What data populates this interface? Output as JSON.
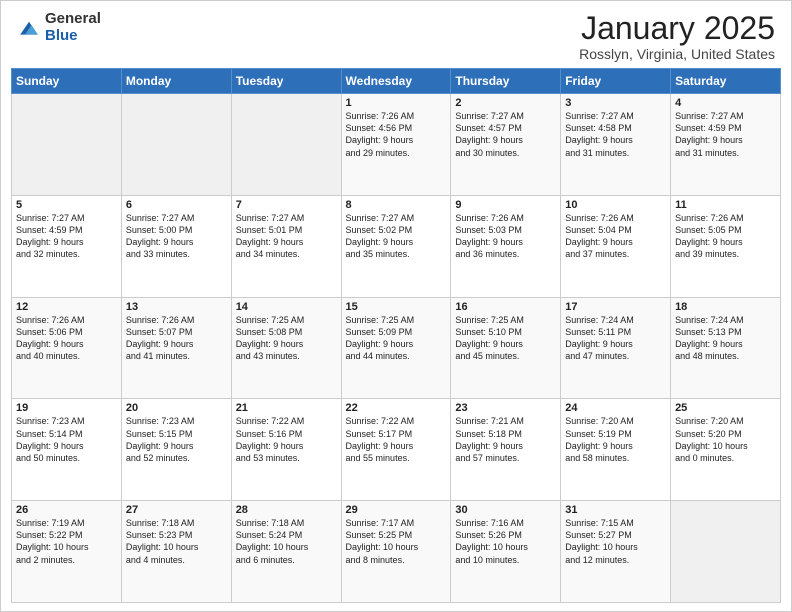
{
  "logo": {
    "general": "General",
    "blue": "Blue"
  },
  "title": "January 2025",
  "subtitle": "Rosslyn, Virginia, United States",
  "days_of_week": [
    "Sunday",
    "Monday",
    "Tuesday",
    "Wednesday",
    "Thursday",
    "Friday",
    "Saturday"
  ],
  "weeks": [
    [
      {
        "day": "",
        "content": ""
      },
      {
        "day": "",
        "content": ""
      },
      {
        "day": "",
        "content": ""
      },
      {
        "day": "1",
        "content": "Sunrise: 7:26 AM\nSunset: 4:56 PM\nDaylight: 9 hours\nand 29 minutes."
      },
      {
        "day": "2",
        "content": "Sunrise: 7:27 AM\nSunset: 4:57 PM\nDaylight: 9 hours\nand 30 minutes."
      },
      {
        "day": "3",
        "content": "Sunrise: 7:27 AM\nSunset: 4:58 PM\nDaylight: 9 hours\nand 31 minutes."
      },
      {
        "day": "4",
        "content": "Sunrise: 7:27 AM\nSunset: 4:59 PM\nDaylight: 9 hours\nand 31 minutes."
      }
    ],
    [
      {
        "day": "5",
        "content": "Sunrise: 7:27 AM\nSunset: 4:59 PM\nDaylight: 9 hours\nand 32 minutes."
      },
      {
        "day": "6",
        "content": "Sunrise: 7:27 AM\nSunset: 5:00 PM\nDaylight: 9 hours\nand 33 minutes."
      },
      {
        "day": "7",
        "content": "Sunrise: 7:27 AM\nSunset: 5:01 PM\nDaylight: 9 hours\nand 34 minutes."
      },
      {
        "day": "8",
        "content": "Sunrise: 7:27 AM\nSunset: 5:02 PM\nDaylight: 9 hours\nand 35 minutes."
      },
      {
        "day": "9",
        "content": "Sunrise: 7:26 AM\nSunset: 5:03 PM\nDaylight: 9 hours\nand 36 minutes."
      },
      {
        "day": "10",
        "content": "Sunrise: 7:26 AM\nSunset: 5:04 PM\nDaylight: 9 hours\nand 37 minutes."
      },
      {
        "day": "11",
        "content": "Sunrise: 7:26 AM\nSunset: 5:05 PM\nDaylight: 9 hours\nand 39 minutes."
      }
    ],
    [
      {
        "day": "12",
        "content": "Sunrise: 7:26 AM\nSunset: 5:06 PM\nDaylight: 9 hours\nand 40 minutes."
      },
      {
        "day": "13",
        "content": "Sunrise: 7:26 AM\nSunset: 5:07 PM\nDaylight: 9 hours\nand 41 minutes."
      },
      {
        "day": "14",
        "content": "Sunrise: 7:25 AM\nSunset: 5:08 PM\nDaylight: 9 hours\nand 43 minutes."
      },
      {
        "day": "15",
        "content": "Sunrise: 7:25 AM\nSunset: 5:09 PM\nDaylight: 9 hours\nand 44 minutes."
      },
      {
        "day": "16",
        "content": "Sunrise: 7:25 AM\nSunset: 5:10 PM\nDaylight: 9 hours\nand 45 minutes."
      },
      {
        "day": "17",
        "content": "Sunrise: 7:24 AM\nSunset: 5:11 PM\nDaylight: 9 hours\nand 47 minutes."
      },
      {
        "day": "18",
        "content": "Sunrise: 7:24 AM\nSunset: 5:13 PM\nDaylight: 9 hours\nand 48 minutes."
      }
    ],
    [
      {
        "day": "19",
        "content": "Sunrise: 7:23 AM\nSunset: 5:14 PM\nDaylight: 9 hours\nand 50 minutes."
      },
      {
        "day": "20",
        "content": "Sunrise: 7:23 AM\nSunset: 5:15 PM\nDaylight: 9 hours\nand 52 minutes."
      },
      {
        "day": "21",
        "content": "Sunrise: 7:22 AM\nSunset: 5:16 PM\nDaylight: 9 hours\nand 53 minutes."
      },
      {
        "day": "22",
        "content": "Sunrise: 7:22 AM\nSunset: 5:17 PM\nDaylight: 9 hours\nand 55 minutes."
      },
      {
        "day": "23",
        "content": "Sunrise: 7:21 AM\nSunset: 5:18 PM\nDaylight: 9 hours\nand 57 minutes."
      },
      {
        "day": "24",
        "content": "Sunrise: 7:20 AM\nSunset: 5:19 PM\nDaylight: 9 hours\nand 58 minutes."
      },
      {
        "day": "25",
        "content": "Sunrise: 7:20 AM\nSunset: 5:20 PM\nDaylight: 10 hours\nand 0 minutes."
      }
    ],
    [
      {
        "day": "26",
        "content": "Sunrise: 7:19 AM\nSunset: 5:22 PM\nDaylight: 10 hours\nand 2 minutes."
      },
      {
        "day": "27",
        "content": "Sunrise: 7:18 AM\nSunset: 5:23 PM\nDaylight: 10 hours\nand 4 minutes."
      },
      {
        "day": "28",
        "content": "Sunrise: 7:18 AM\nSunset: 5:24 PM\nDaylight: 10 hours\nand 6 minutes."
      },
      {
        "day": "29",
        "content": "Sunrise: 7:17 AM\nSunset: 5:25 PM\nDaylight: 10 hours\nand 8 minutes."
      },
      {
        "day": "30",
        "content": "Sunrise: 7:16 AM\nSunset: 5:26 PM\nDaylight: 10 hours\nand 10 minutes."
      },
      {
        "day": "31",
        "content": "Sunrise: 7:15 AM\nSunset: 5:27 PM\nDaylight: 10 hours\nand 12 minutes."
      },
      {
        "day": "",
        "content": ""
      }
    ]
  ]
}
